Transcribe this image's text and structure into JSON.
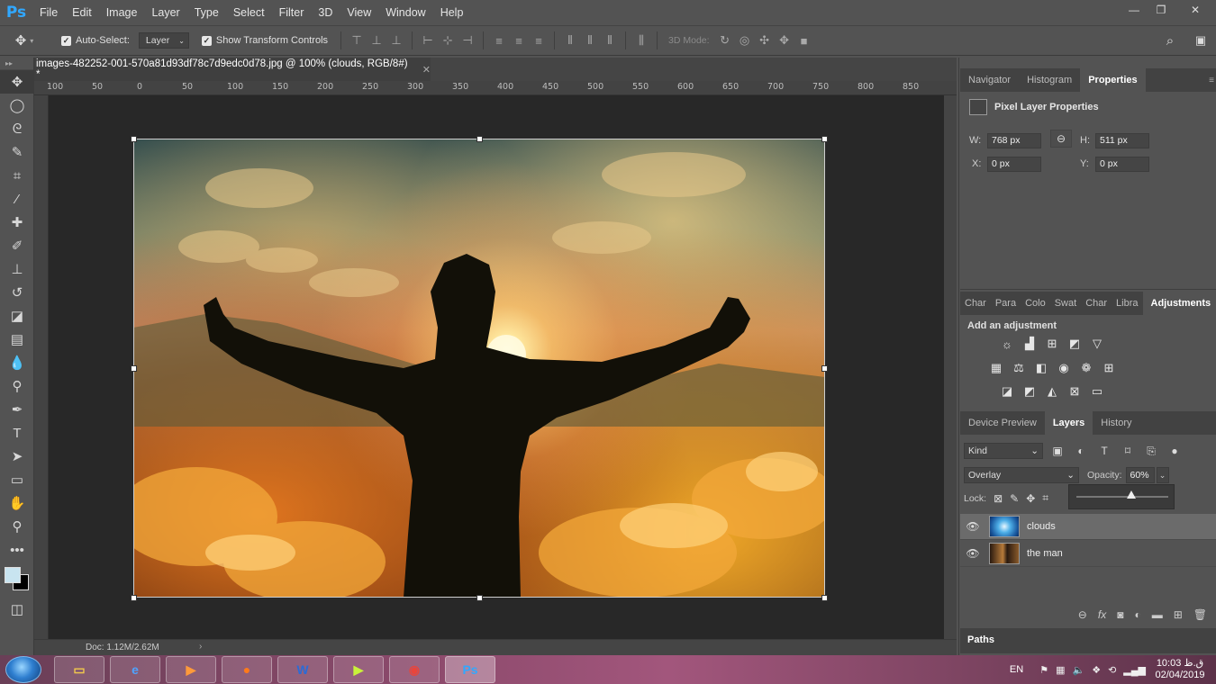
{
  "app": {
    "logo": "Ps"
  },
  "menu": [
    "File",
    "Edit",
    "Image",
    "Layer",
    "Type",
    "Select",
    "Filter",
    "3D",
    "View",
    "Window",
    "Help"
  ],
  "window_controls": {
    "minimize": "—",
    "restore": "❐",
    "close": "✕"
  },
  "options": {
    "auto_select_label": "Auto-Select:",
    "auto_select_checked": true,
    "auto_select_target": "Layer",
    "show_transform_label": "Show Transform Controls",
    "show_transform_checked": true,
    "mode_3d_label": "3D Mode:"
  },
  "document": {
    "tab_title": "images-482252-001-570a81d93df78c7d9edc0d78.jpg @ 100% (clouds, RGB/8#) *",
    "ruler_ticks": [
      "100",
      "50",
      "0",
      "50",
      "100",
      "150",
      "200",
      "250",
      "300",
      "350",
      "400",
      "450",
      "500",
      "550",
      "600",
      "650",
      "700",
      "750",
      "800",
      "850"
    ],
    "status_doc": "Doc: 1.12M/2.62M"
  },
  "panels": {
    "top_tabs": [
      "Navigator",
      "Histogram",
      "Properties"
    ],
    "top_active": "Properties",
    "properties": {
      "title": "Pixel Layer Properties",
      "w_label": "W:",
      "w_value": "768 px",
      "h_label": "H:",
      "h_value": "511 px",
      "x_label": "X:",
      "x_value": "0 px",
      "y_label": "Y:",
      "y_value": "0 px"
    },
    "mid_tabs": [
      "Char",
      "Para",
      "Colo",
      "Swat",
      "Char",
      "Libra",
      "Adjustments"
    ],
    "mid_active": "Adjustments",
    "adjustments_title": "Add an adjustment",
    "layers_tabs": [
      "Device Preview",
      "Layers",
      "History"
    ],
    "layers_active": "Layers",
    "layers": {
      "filter_kind": "Kind",
      "blend_mode": "Overlay",
      "opacity_label": "Opacity:",
      "opacity_value": "60%",
      "opacity_level": 0.6,
      "lock_label": "Lock:",
      "items": [
        {
          "name": "clouds",
          "selected": true,
          "visible": true
        },
        {
          "name": "the man",
          "selected": false,
          "visible": true
        }
      ]
    },
    "paths_tab": "Paths"
  },
  "taskbar": {
    "language": "EN",
    "time": "10:03 ق.ظ",
    "date": "02/04/2019"
  },
  "colors": {
    "foreground": "#c8e4f0",
    "background": "#000000",
    "accent": "#31a8ff"
  }
}
